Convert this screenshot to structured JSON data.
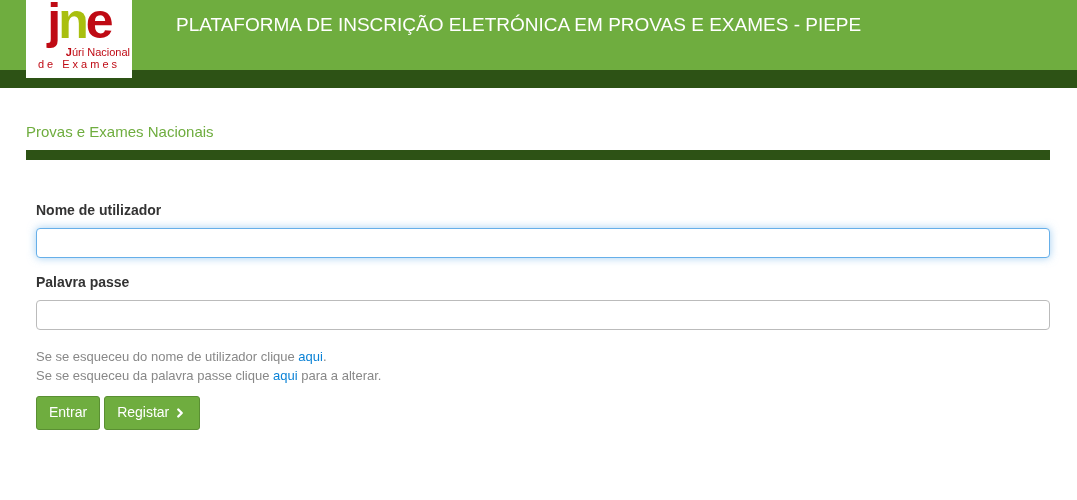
{
  "logo": {
    "letters": [
      "j",
      "n",
      "e"
    ],
    "line_1_bold": "J",
    "line_1": "úri Nacional",
    "line_2": "de Exames"
  },
  "header": {
    "title": "PLATAFORMA DE INSCRIÇÃO ELETRÓNICA EM PROVAS E EXAMES - PIEPE"
  },
  "section": {
    "title": "Provas e Exames Nacionais"
  },
  "fields": [
    {
      "label": "Nome de utilizador",
      "focused": true
    },
    {
      "label": "Palavra passe",
      "focused": false
    }
  ],
  "help": [
    {
      "before": "Se se esqueceu do nome de utilizador clique ",
      "link": "aqui",
      "after": "."
    },
    {
      "before": "Se se esqueceu da palavra passe clique ",
      "link": "aqui",
      "after": " para a alterar."
    }
  ],
  "buttons": [
    {
      "label": "Entrar",
      "kind": "plain"
    },
    {
      "label": "Registar",
      "kind": "next"
    }
  ]
}
